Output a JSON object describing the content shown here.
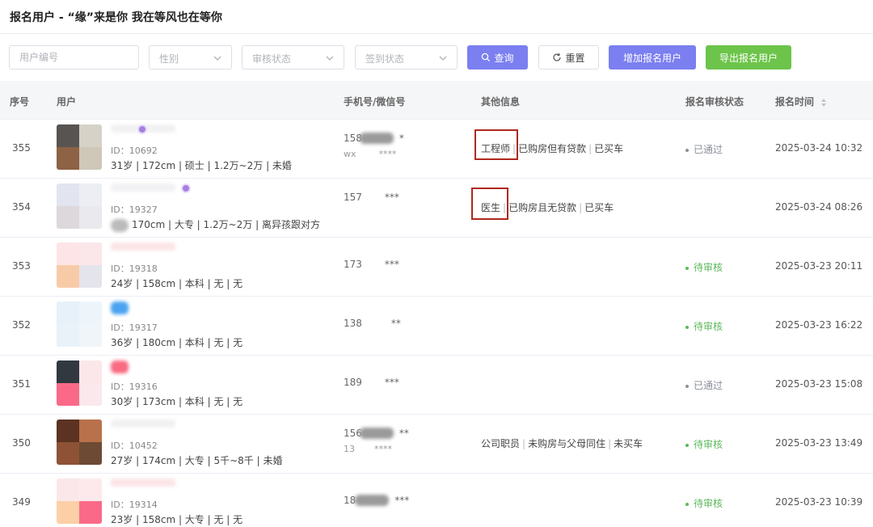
{
  "header": {
    "title": "报名用户 - “缘”来是你 我在等风也在等你"
  },
  "filters": {
    "user_id_placeholder": "用户编号",
    "gender_placeholder": "性别",
    "review_status_placeholder": "审核状态",
    "checkin_status_placeholder": "签到状态"
  },
  "buttons": {
    "search": "查询",
    "reset": "重置",
    "add": "增加报名用户",
    "export": "导出报名用户"
  },
  "colors": {
    "accent": "#7b7ff0",
    "success": "#6cc44a",
    "pending": "#5cb85c",
    "approved": "#8a8f99",
    "highlight": "#b0281e"
  },
  "table": {
    "columns": [
      "序号",
      "用户",
      "手机号/微信号",
      "其他信息",
      "报名审核状态",
      "报名时间"
    ],
    "rows": [
      {
        "seq": "355",
        "id": "ID：10692",
        "detail": "31岁 | 172cm | 硕士 | 1.2万~2万 | 未婚",
        "phone": "158",
        "phone_suffix": "*",
        "wechat": "wx",
        "wechat_suffix": "****",
        "other": [
          "工程师",
          "已购房但有贷款",
          "已买车"
        ],
        "status": "已通过",
        "time": "2025-03-24 10:32"
      },
      {
        "seq": "354",
        "id": "ID：19327",
        "detail": "170cm | 大专 | 1.2万~2万 | 离异孩跟对方",
        "phone": "157",
        "phone_suffix": "***",
        "wechat": "",
        "wechat_suffix": "",
        "other": [
          "医生",
          "已购房且无贷款",
          "已买车"
        ],
        "status": "",
        "time": "2025-03-24 08:26"
      },
      {
        "seq": "353",
        "id": "ID：19318",
        "detail": "24岁 | 158cm | 本科 | 无 | 无",
        "phone": "173",
        "phone_suffix": "***",
        "wechat": "",
        "wechat_suffix": "",
        "other": [],
        "status": "待审核",
        "time": "2025-03-23 20:11"
      },
      {
        "seq": "352",
        "id": "ID：19317",
        "detail": "36岁 | 180cm | 本科 | 无 | 无",
        "phone": "138",
        "phone_suffix": "**",
        "wechat": "",
        "wechat_suffix": "",
        "other": [],
        "status": "待审核",
        "time": "2025-03-23 16:22"
      },
      {
        "seq": "351",
        "id": "ID：19316",
        "detail": "30岁 | 173cm | 本科 | 无 | 无",
        "phone": "189",
        "phone_suffix": "***",
        "wechat": "",
        "wechat_suffix": "",
        "other": [],
        "status": "已通过",
        "time": "2025-03-23 15:08"
      },
      {
        "seq": "350",
        "id": "ID：10452",
        "detail": "27岁 | 174cm | 大专 | 5千~8千 | 未婚",
        "phone": "156",
        "phone_suffix": "**",
        "wechat": "13",
        "wechat_suffix": "****",
        "other": [
          "公司职员",
          "未购房与父母同住",
          "未买车"
        ],
        "status": "待审核",
        "time": "2025-03-23 13:49"
      },
      {
        "seq": "349",
        "id": "ID：19314",
        "detail": "23岁 | 158cm | 大专 | 无 | 无",
        "phone": "18",
        "phone_suffix": "***",
        "wechat": "",
        "wechat_suffix": "",
        "other": [],
        "status": "待审核",
        "time": "2025-03-23 10:39"
      }
    ]
  }
}
